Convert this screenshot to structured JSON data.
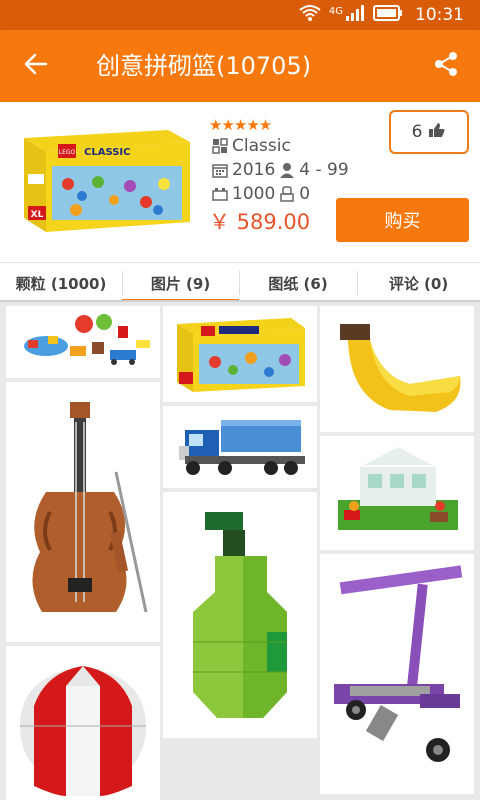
{
  "status_bar": {
    "time": "10:31",
    "network": "4G",
    "icons": [
      "wifi-icon",
      "signal-icon",
      "battery-icon"
    ]
  },
  "app_bar": {
    "title": "创意拼砌篮(10705)",
    "back_icon": "back-arrow-icon",
    "share_icon": "share-icon"
  },
  "product": {
    "rating_stars": "★★★★★",
    "rating": 5,
    "theme": "Classic",
    "year": "2016",
    "age_range": "4 - 99",
    "pieces": "1000",
    "minifigs": "0",
    "price": "￥ 589.00",
    "likes": "6",
    "buy_label": "购买"
  },
  "tabs": [
    {
      "label": "颗粒 (1000)"
    },
    {
      "label": "图片 (9)"
    },
    {
      "label": "图纸 (6)"
    },
    {
      "label": "评论 (0)"
    }
  ],
  "active_tab": 1,
  "colors": {
    "accent": "#f7780d",
    "status_bar": "#d95c08",
    "price": "#e8542a"
  },
  "gallery": [
    {
      "name": "gallery-image-assorted-models"
    },
    {
      "name": "gallery-image-violin"
    },
    {
      "name": "gallery-image-hot-air-balloon"
    },
    {
      "name": "gallery-image-box"
    },
    {
      "name": "gallery-image-truck"
    },
    {
      "name": "gallery-image-pear"
    },
    {
      "name": "gallery-image-banana"
    },
    {
      "name": "gallery-image-greenhouse"
    },
    {
      "name": "gallery-image-scooter"
    }
  ]
}
